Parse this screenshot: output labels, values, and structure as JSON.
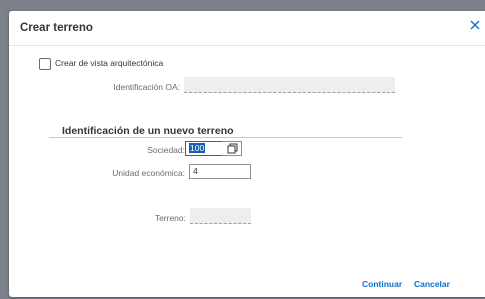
{
  "dialog": {
    "title": "Crear terreno",
    "close_icon": "close-icon"
  },
  "arch_view": {
    "checkbox_label": "Crear de vista arquitectónica",
    "checked": false,
    "oa_label": "Identificación OA:",
    "oa_value": ""
  },
  "new_land": {
    "section_title": "Identificación de un nuevo terreno",
    "company_label": "Sociedad:",
    "company_value": "100",
    "value_help_icon": "value-help-icon",
    "econ_unit_label": "Unidad económica:",
    "econ_unit_value": "4",
    "land_label": "Terreno:",
    "land_value": ""
  },
  "footer": {
    "continue_label": "Continuar",
    "cancel_label": "Cancelar"
  },
  "colors": {
    "accent": "#0a6ed1",
    "text": "#32363a",
    "label": "#6a6d70"
  }
}
